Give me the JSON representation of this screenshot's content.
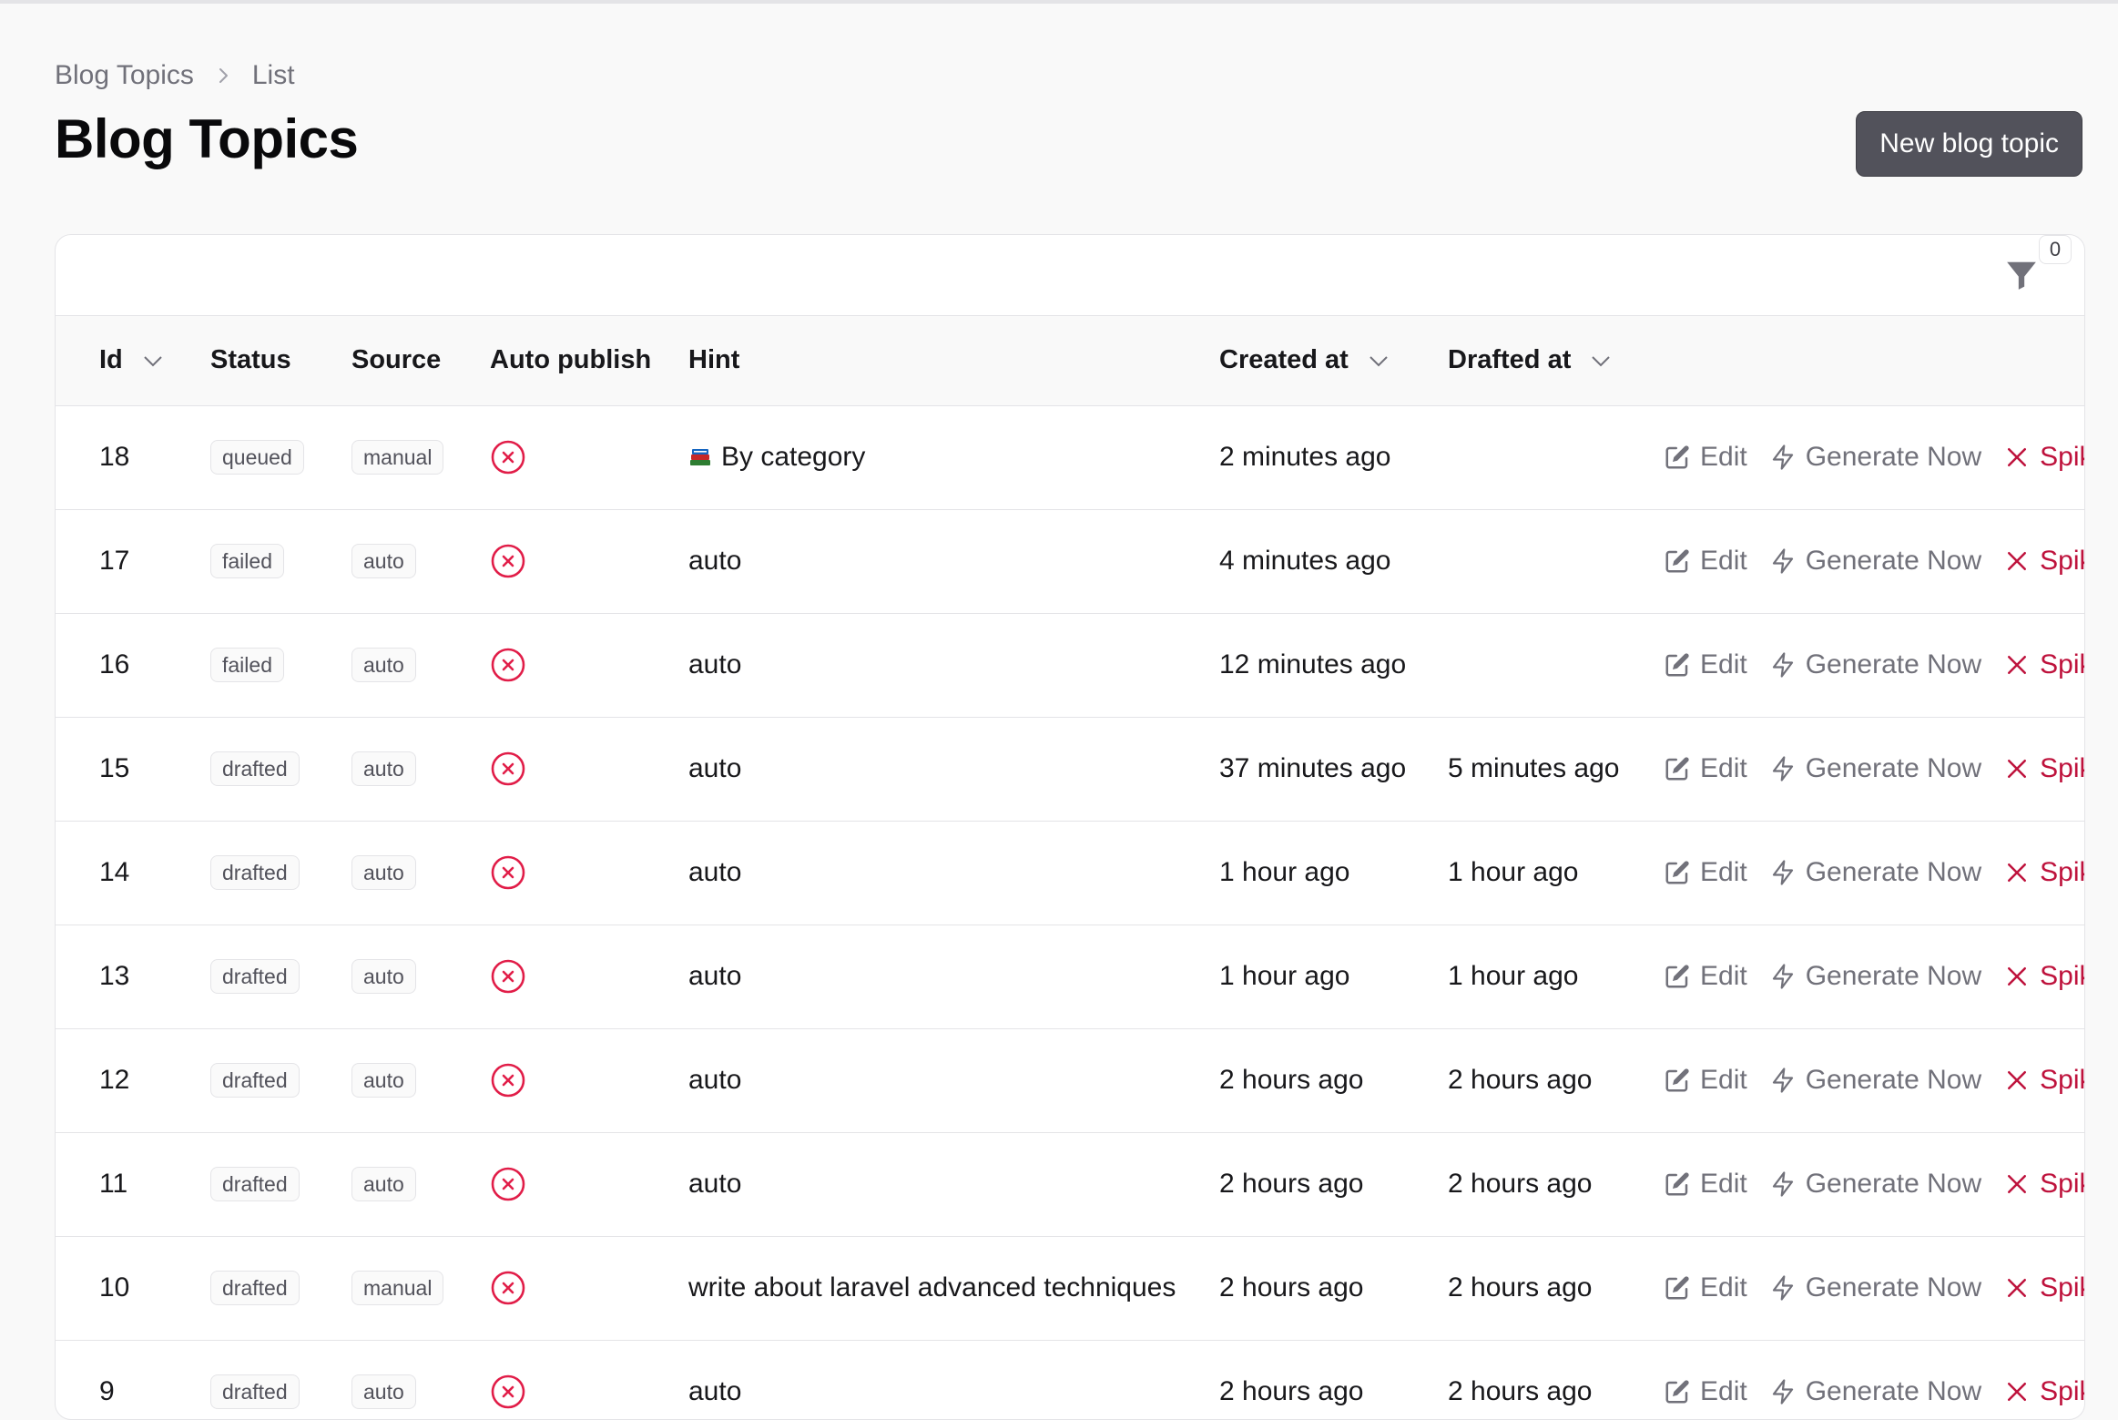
{
  "breadcrumb": {
    "root": "Blog Topics",
    "current": "List"
  },
  "page": {
    "title": "Blog Topics"
  },
  "header": {
    "new_button": "New blog topic"
  },
  "filters": {
    "count": "0"
  },
  "columns": {
    "id": "Id",
    "status": "Status",
    "source": "Source",
    "auto_publish": "Auto publish",
    "hint": "Hint",
    "created_at": "Created at",
    "drafted_at": "Drafted at"
  },
  "actions": {
    "edit": "Edit",
    "generate": "Generate Now",
    "spike": "Spike"
  },
  "colors": {
    "accent": "#52525b",
    "danger": "#be123c",
    "border": "#e4e4e7"
  },
  "rows": [
    {
      "id": "18",
      "status": "queued",
      "source": "manual",
      "hint": "By category",
      "hint_icon": "books-emoji",
      "created": "2 minutes ago",
      "drafted": ""
    },
    {
      "id": "17",
      "status": "failed",
      "source": "auto",
      "hint": "auto",
      "created": "4 minutes ago",
      "drafted": ""
    },
    {
      "id": "16",
      "status": "failed",
      "source": "auto",
      "hint": "auto",
      "created": "12 minutes ago",
      "drafted": ""
    },
    {
      "id": "15",
      "status": "drafted",
      "source": "auto",
      "hint": "auto",
      "created": "37 minutes ago",
      "drafted": "5 minutes ago"
    },
    {
      "id": "14",
      "status": "drafted",
      "source": "auto",
      "hint": "auto",
      "created": "1 hour ago",
      "drafted": "1 hour ago"
    },
    {
      "id": "13",
      "status": "drafted",
      "source": "auto",
      "hint": "auto",
      "created": "1 hour ago",
      "drafted": "1 hour ago"
    },
    {
      "id": "12",
      "status": "drafted",
      "source": "auto",
      "hint": "auto",
      "created": "2 hours ago",
      "drafted": "2 hours ago"
    },
    {
      "id": "11",
      "status": "drafted",
      "source": "auto",
      "hint": "auto",
      "created": "2 hours ago",
      "drafted": "2 hours ago"
    },
    {
      "id": "10",
      "status": "drafted",
      "source": "manual",
      "hint": "write about laravel advanced techniques",
      "created": "2 hours ago",
      "drafted": "2 hours ago"
    },
    {
      "id": "9",
      "status": "drafted",
      "source": "auto",
      "hint": "auto",
      "created": "2 hours ago",
      "drafted": "2 hours ago"
    }
  ]
}
